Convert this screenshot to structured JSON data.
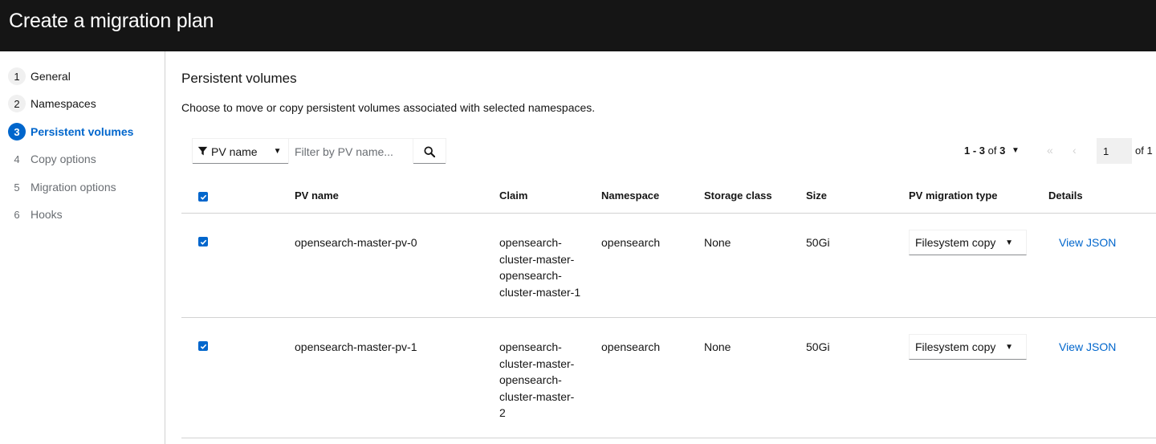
{
  "header": {
    "title": "Create a migration plan"
  },
  "wizard": {
    "steps": [
      {
        "num": "1",
        "label": "General"
      },
      {
        "num": "2",
        "label": "Namespaces"
      },
      {
        "num": "3",
        "label": "Persistent volumes"
      },
      {
        "num": "4",
        "label": "Copy options"
      },
      {
        "num": "5",
        "label": "Migration options"
      },
      {
        "num": "6",
        "label": "Hooks"
      }
    ],
    "active_step": "3"
  },
  "page": {
    "title": "Persistent volumes",
    "description": "Choose to move or copy persistent volumes associated with selected namespaces."
  },
  "filter": {
    "type_label": "PV name",
    "placeholder": "Filter by PV name..."
  },
  "pagination": {
    "range": "1 - 3",
    "of_label": "of",
    "total": "3",
    "page": "1",
    "page_of": "of 1"
  },
  "table": {
    "columns": [
      "PV name",
      "Claim",
      "Namespace",
      "Storage class",
      "Size",
      "PV migration type",
      "Details"
    ],
    "rows": [
      {
        "selected": true,
        "pv_name": "opensearch-master-pv-0",
        "claim_lines": [
          "opensearch-",
          "cluster-master-",
          "opensearch-",
          "cluster-master-1"
        ],
        "namespace": "opensearch",
        "storage_class": "None",
        "size": "50Gi",
        "migration_type": "Filesystem copy",
        "details": "View JSON"
      },
      {
        "selected": true,
        "pv_name": "opensearch-master-pv-1",
        "claim_lines": [
          "opensearch-",
          "cluster-master-",
          "opensearch-",
          "cluster-master-",
          "2"
        ],
        "namespace": "opensearch",
        "storage_class": "None",
        "size": "50Gi",
        "migration_type": "Filesystem copy",
        "details": "View JSON"
      }
    ]
  },
  "colors": {
    "accent": "#0066cc",
    "header_bg": "#151515",
    "border": "#d2d2d2",
    "muted": "#6a6e73"
  },
  "icons": [
    "filter-icon",
    "caret-down-icon",
    "search-icon",
    "double-angle-left-icon",
    "angle-left-icon",
    "check-icon"
  ]
}
